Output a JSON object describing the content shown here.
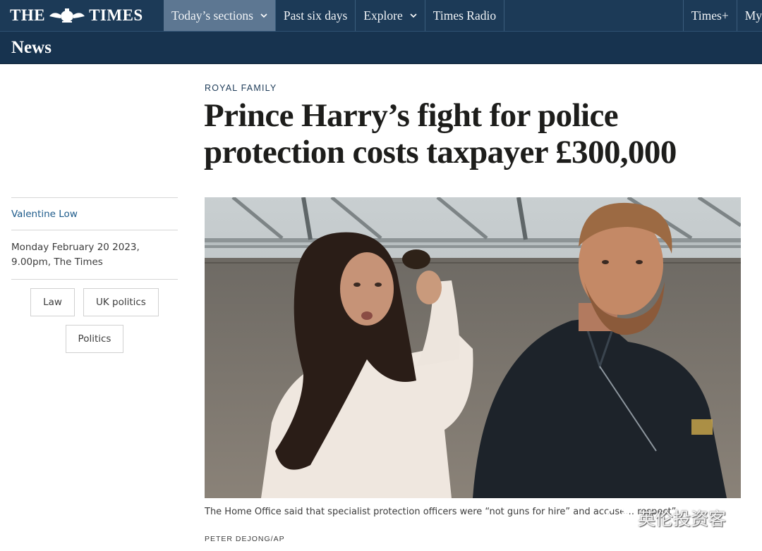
{
  "masthead": {
    "logo_text_left": "THE",
    "logo_text_right": "TIMES",
    "nav": [
      {
        "label": "Today’s sections",
        "has_dropdown": true,
        "active": true
      },
      {
        "label": "Past six days",
        "has_dropdown": false
      },
      {
        "label": "Explore",
        "has_dropdown": true
      },
      {
        "label": "Times Radio",
        "has_dropdown": false
      }
    ],
    "right_nav": [
      {
        "label": "Times+"
      },
      {
        "label": "My"
      }
    ]
  },
  "section": {
    "title": "News"
  },
  "article": {
    "kicker": "ROYAL FAMILY",
    "headline": "Prince Harry’s fight for police protection costs taxpayer £300,000",
    "author": "Valentine Low",
    "dateline": "Monday February 20 2023, 9.00pm, The Times",
    "tags": [
      "Law",
      "UK politics",
      "Politics"
    ],
    "caption": "The Home Office said that specialist protection officers were “not guns for hire” and accuse… respect”",
    "credit": "PETER DEJONG/AP"
  },
  "watermark": {
    "text": "英伦投资客",
    "icon": "wechat-bubble-icon"
  },
  "colors": {
    "masthead_bg": "#1c3a57",
    "section_bg": "#17334f",
    "active_tab": "#5d7792",
    "link": "#1c5a8a"
  }
}
